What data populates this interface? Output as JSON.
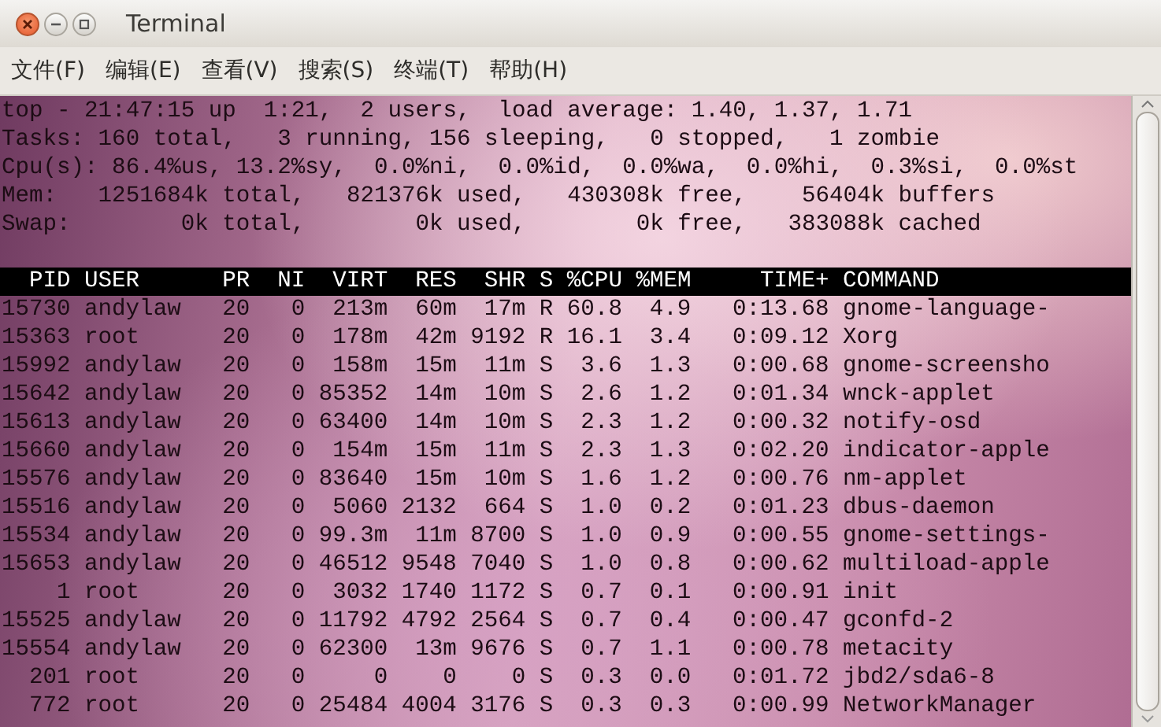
{
  "window": {
    "title": "Terminal"
  },
  "menu": [
    "文件(F)",
    "编辑(E)",
    "查看(V)",
    "搜索(S)",
    "终端(T)",
    "帮助(H)"
  ],
  "summary": [
    "top - 21:47:15 up  1:21,  2 users,  load average: 1.40, 1.37, 1.71",
    "Tasks: 160 total,   3 running, 156 sleeping,   0 stopped,   1 zombie",
    "Cpu(s): 86.4%us, 13.2%sy,  0.0%ni,  0.0%id,  0.0%wa,  0.0%hi,  0.3%si,  0.0%st",
    "Mem:   1251684k total,   821376k used,   430308k free,    56404k buffers",
    "Swap:        0k total,        0k used,        0k free,   383088k cached"
  ],
  "table": {
    "columns": [
      "PID",
      "USER",
      "PR",
      "NI",
      "VIRT",
      "RES",
      "SHR",
      "S",
      "%CPU",
      "%MEM",
      "TIME+",
      "COMMAND"
    ],
    "rows": [
      [
        "15730",
        "andylaw",
        "20",
        "0",
        "213m",
        "60m",
        "17m",
        "R",
        "60.8",
        "4.9",
        "0:13.68",
        "gnome-language-"
      ],
      [
        "15363",
        "root",
        "20",
        "0",
        "178m",
        "42m",
        "9192",
        "R",
        "16.1",
        "3.4",
        "0:09.12",
        "Xorg"
      ],
      [
        "15992",
        "andylaw",
        "20",
        "0",
        "158m",
        "15m",
        "11m",
        "S",
        "3.6",
        "1.3",
        "0:00.68",
        "gnome-screensho"
      ],
      [
        "15642",
        "andylaw",
        "20",
        "0",
        "85352",
        "14m",
        "10m",
        "S",
        "2.6",
        "1.2",
        "0:01.34",
        "wnck-applet"
      ],
      [
        "15613",
        "andylaw",
        "20",
        "0",
        "63400",
        "14m",
        "10m",
        "S",
        "2.3",
        "1.2",
        "0:00.32",
        "notify-osd"
      ],
      [
        "15660",
        "andylaw",
        "20",
        "0",
        "154m",
        "15m",
        "11m",
        "S",
        "2.3",
        "1.3",
        "0:02.20",
        "indicator-apple"
      ],
      [
        "15576",
        "andylaw",
        "20",
        "0",
        "83640",
        "15m",
        "10m",
        "S",
        "1.6",
        "1.2",
        "0:00.76",
        "nm-applet"
      ],
      [
        "15516",
        "andylaw",
        "20",
        "0",
        "5060",
        "2132",
        "664",
        "S",
        "1.0",
        "0.2",
        "0:01.23",
        "dbus-daemon"
      ],
      [
        "15534",
        "andylaw",
        "20",
        "0",
        "99.3m",
        "11m",
        "8700",
        "S",
        "1.0",
        "0.9",
        "0:00.55",
        "gnome-settings-"
      ],
      [
        "15653",
        "andylaw",
        "20",
        "0",
        "46512",
        "9548",
        "7040",
        "S",
        "1.0",
        "0.8",
        "0:00.62",
        "multiload-apple"
      ],
      [
        "1",
        "root",
        "20",
        "0",
        "3032",
        "1740",
        "1172",
        "S",
        "0.7",
        "0.1",
        "0:00.91",
        "init"
      ],
      [
        "15525",
        "andylaw",
        "20",
        "0",
        "11792",
        "4792",
        "2564",
        "S",
        "0.7",
        "0.4",
        "0:00.47",
        "gconfd-2"
      ],
      [
        "15554",
        "andylaw",
        "20",
        "0",
        "62300",
        "13m",
        "9676",
        "S",
        "0.7",
        "1.1",
        "0:00.78",
        "metacity"
      ],
      [
        "201",
        "root",
        "20",
        "0",
        "0",
        "0",
        "0",
        "S",
        "0.3",
        "0.0",
        "0:01.72",
        "jbd2/sda6-8"
      ],
      [
        "772",
        "root",
        "20",
        "0",
        "25484",
        "4004",
        "3176",
        "S",
        "0.3",
        "0.3",
        "0:00.99",
        "NetworkManager"
      ]
    ]
  }
}
